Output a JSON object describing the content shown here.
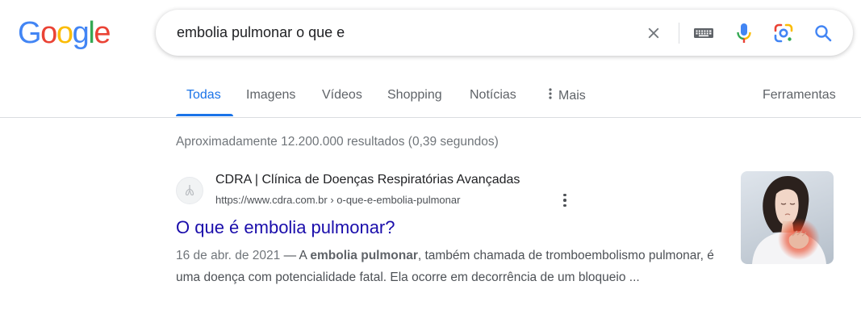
{
  "logo": {
    "letters": [
      "G",
      "o",
      "o",
      "g",
      "l",
      "e"
    ],
    "colors": [
      "#4285F4",
      "#EA4335",
      "#FBBC05",
      "#4285F4",
      "#34A853",
      "#EA4335"
    ]
  },
  "search": {
    "query": "embolia pulmonar o que e",
    "icons": [
      "close-icon",
      "keyboard-icon",
      "microphone-icon",
      "lens-icon",
      "search-icon"
    ]
  },
  "tabs": {
    "items": [
      {
        "label": "Todas",
        "active": true
      },
      {
        "label": "Imagens",
        "active": false
      },
      {
        "label": "Vídeos",
        "active": false
      },
      {
        "label": "Shopping",
        "active": false
      },
      {
        "label": "Notícias",
        "active": false
      },
      {
        "label": "Mais",
        "active": false
      }
    ],
    "tools": "Ferramentas"
  },
  "stats": "Aproximadamente 12.200.000 resultados (0,39 segundos)",
  "result": {
    "site_name": "CDRA | Clínica de Doenças Respiratórias Avançadas",
    "url": "https://www.cdra.com.br › o-que-e-embolia-pulmonar",
    "title": "O que é embolia pulmonar?",
    "snippet": {
      "date": "16 de abr. de 2021",
      "sep": " — A ",
      "bold": "embolia pulmonar",
      "rest": ", também chamada de tromboembolismo pulmonar, é uma doença com potencialidade fatal. Ela ocorre em decorrência de um bloqueio ..."
    }
  },
  "colors": {
    "accent": "#1a73e8",
    "link": "#1a0dab",
    "text": "#202124",
    "muted": "#70757a"
  }
}
